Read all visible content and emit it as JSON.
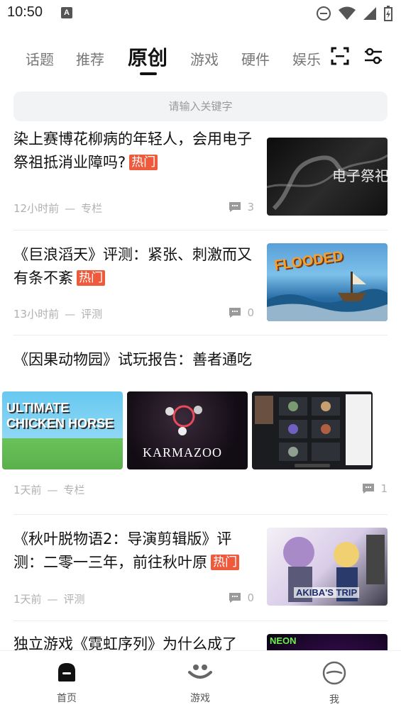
{
  "status": {
    "time": "10:50",
    "notification_badge": "A"
  },
  "tabs": [
    {
      "label": "话题"
    },
    {
      "label": "推荐"
    },
    {
      "label": "原创"
    },
    {
      "label": "游戏"
    },
    {
      "label": "硬件"
    },
    {
      "label": "娱乐"
    }
  ],
  "active_tab": "原创",
  "search": {
    "placeholder": "请输入关键字"
  },
  "articles": [
    {
      "title": "染上赛博花柳病的年轻人，会用电子祭祖抵消业障吗?",
      "hot": "热门",
      "time": "12小时前",
      "category": "专栏",
      "comments": "3",
      "thumb_text": "电子祭祀"
    },
    {
      "title": "《巨浪滔天》评测：紧张、刺激而又有条不紊",
      "hot": "热门",
      "time": "13小时前",
      "category": "评测",
      "comments": "0",
      "thumb_text": "FLOODED"
    },
    {
      "title": "《因果动物园》试玩报告：善者通吃",
      "time": "1天前",
      "category": "专栏",
      "comments": "1",
      "images": [
        "ULTIMATE CHICKEN HORSE",
        "KARMAZOO",
        ""
      ]
    },
    {
      "title": "《秋叶脱物语2：导演剪辑版》评测：二零一三年，前往秋叶原",
      "hot": "热门",
      "time": "1天前",
      "category": "评测",
      "comments": "0",
      "thumb_text": "AKIBA'S TRIP"
    },
    {
      "title": "独立游戏《霓虹序列》为什么成了",
      "thumb_text": "NEON"
    }
  ],
  "bottom_nav": [
    {
      "label": "首页"
    },
    {
      "label": "游戏"
    },
    {
      "label": "我"
    }
  ],
  "colors": {
    "hot_tag": "#f05a3c",
    "active_tab": "#111111",
    "inactive_tab": "#777777",
    "meta": "#b0b0b0",
    "search_bg": "#f2f3f5"
  }
}
